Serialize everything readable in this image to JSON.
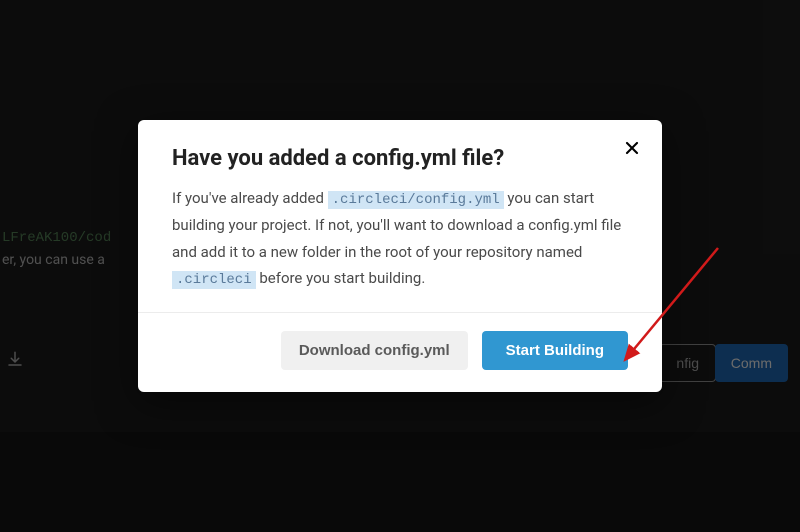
{
  "background": {
    "repo_text": "LFreAK100/cod",
    "helper_text": "er, you can use a",
    "download_icon_label": "download",
    "button1_label": "nfig",
    "button2_label": "Comm"
  },
  "modal": {
    "title": "Have you added a config.yml file?",
    "desc_part1": "If you've already added ",
    "code1": ".circleci/config.yml",
    "desc_part2": " you can start building your project. If not, you'll want to download a config.yml file and add it to a new folder in the root of your repository named ",
    "code2": ".circleci",
    "desc_part3": " before you start building.",
    "close_label": "Close",
    "download_button": "Download config.yml",
    "start_button": "Start Building"
  },
  "annotation": {
    "arrow_color": "#d11a1a"
  }
}
